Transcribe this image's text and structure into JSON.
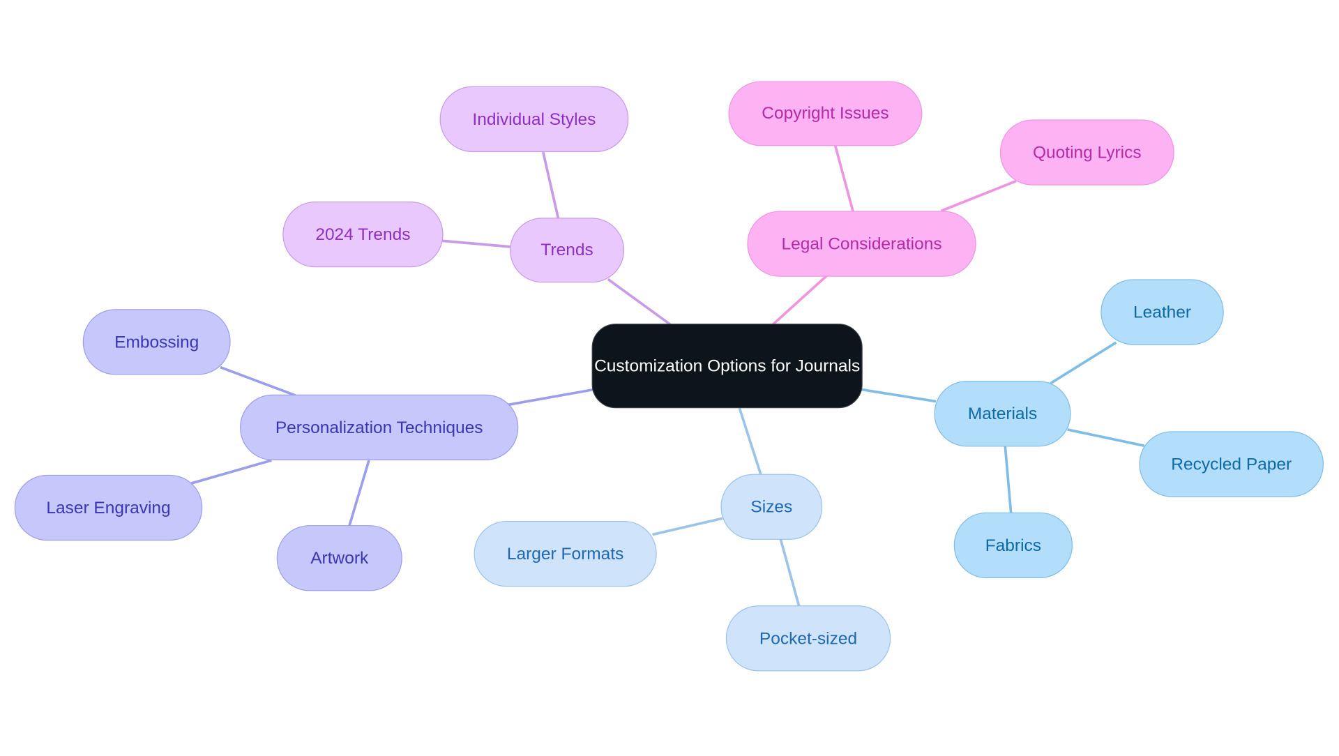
{
  "diagram": {
    "type": "mind-map",
    "root": {
      "label": "Customization Options for Journals"
    },
    "branches": [
      {
        "id": "trends",
        "label": "Trends",
        "color": "#c79be6",
        "children": [
          {
            "label": "Individual Styles"
          },
          {
            "label": "2024 Trends"
          }
        ]
      },
      {
        "id": "legal",
        "label": "Legal Considerations",
        "color": "#ef94e0",
        "children": [
          {
            "label": "Copyright Issues"
          },
          {
            "label": "Quoting Lyrics"
          }
        ]
      },
      {
        "id": "materials",
        "label": "Materials",
        "color": "#7fbde6",
        "children": [
          {
            "label": "Leather"
          },
          {
            "label": "Recycled Paper"
          },
          {
            "label": "Fabrics"
          }
        ]
      },
      {
        "id": "sizes",
        "label": "Sizes",
        "color": "#9cc3ea",
        "children": [
          {
            "label": "Larger Formats"
          },
          {
            "label": "Pocket-sized"
          }
        ]
      },
      {
        "id": "personalization",
        "label": "Personalization Techniques",
        "color": "#9b9eea",
        "children": [
          {
            "label": "Embossing"
          },
          {
            "label": "Laser Engraving"
          },
          {
            "label": "Artwork"
          }
        ]
      }
    ]
  }
}
